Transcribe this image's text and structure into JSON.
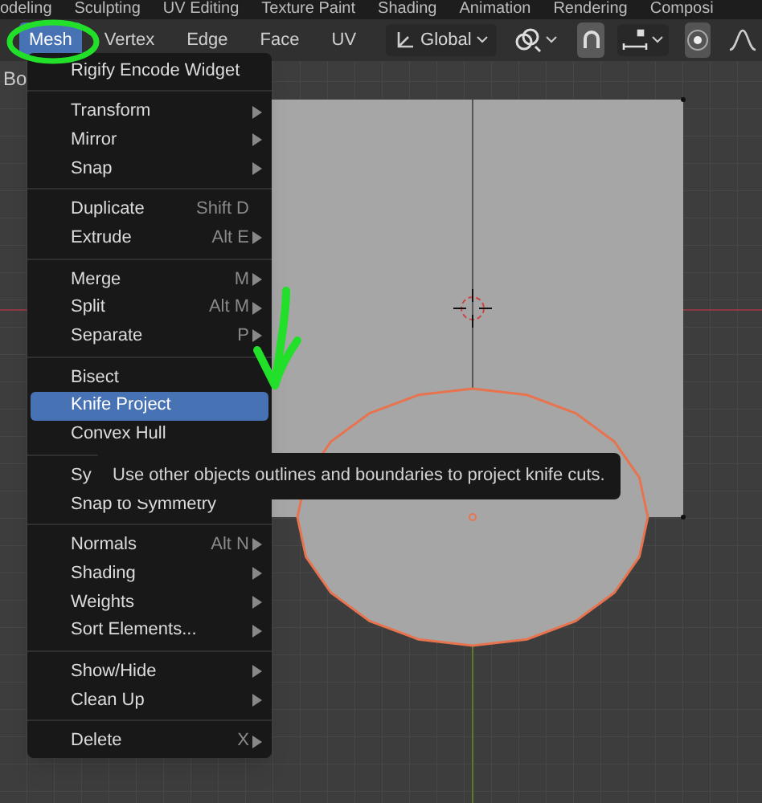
{
  "workspace_tabs": [
    "odeling",
    "Sculpting",
    "UV Editing",
    "Texture Paint",
    "Shading",
    "Animation",
    "Rendering",
    "Composi"
  ],
  "header": {
    "menus": [
      {
        "label": "Mesh",
        "selected": true
      },
      {
        "label": "Vertex",
        "selected": false
      },
      {
        "label": "Edge",
        "selected": false
      },
      {
        "label": "Face",
        "selected": false
      },
      {
        "label": "UV",
        "selected": false
      }
    ],
    "transform_orientation": "Global",
    "snap_on": true,
    "proportional_editing_on": true
  },
  "side_label": "Bo",
  "menu": {
    "items": [
      {
        "kind": "item",
        "label": "Rigify Encode Widget",
        "selected": false
      },
      {
        "kind": "separator"
      },
      {
        "kind": "item",
        "label": "Transform",
        "submenu": true,
        "selected": false
      },
      {
        "kind": "item",
        "label": "Mirror",
        "submenu": true,
        "selected": false
      },
      {
        "kind": "item",
        "label": "Snap",
        "submenu": true,
        "selected": false
      },
      {
        "kind": "separator"
      },
      {
        "kind": "item",
        "label": "Duplicate",
        "shortcut": "Shift D",
        "selected": false
      },
      {
        "kind": "item",
        "label": "Extrude",
        "shortcut": "Alt E",
        "submenu": true,
        "selected": false
      },
      {
        "kind": "separator"
      },
      {
        "kind": "item",
        "label": "Merge",
        "shortcut": "M",
        "submenu": true,
        "selected": false
      },
      {
        "kind": "item",
        "label": "Split",
        "shortcut": "Alt M",
        "submenu": true,
        "selected": false
      },
      {
        "kind": "item",
        "label": "Separate",
        "shortcut": "P",
        "submenu": true,
        "selected": false
      },
      {
        "kind": "separator"
      },
      {
        "kind": "item",
        "label": "Bisect",
        "selected": false
      },
      {
        "kind": "item",
        "label": "Knife Project",
        "selected": true
      },
      {
        "kind": "item",
        "label": "Convex Hull",
        "selected": false
      },
      {
        "kind": "separator"
      },
      {
        "kind": "item",
        "label": "Sy",
        "selected": false
      },
      {
        "kind": "item",
        "label": "Snap to Symmetry",
        "selected": false
      },
      {
        "kind": "separator"
      },
      {
        "kind": "item",
        "label": "Normals",
        "shortcut": "Alt N",
        "submenu": true,
        "selected": false
      },
      {
        "kind": "item",
        "label": "Shading",
        "submenu": true,
        "selected": false
      },
      {
        "kind": "item",
        "label": "Weights",
        "submenu": true,
        "selected": false
      },
      {
        "kind": "item",
        "label": "Sort Elements...",
        "submenu": true,
        "selected": false
      },
      {
        "kind": "separator"
      },
      {
        "kind": "item",
        "label": "Show/Hide",
        "submenu": true,
        "selected": false
      },
      {
        "kind": "item",
        "label": "Clean Up",
        "submenu": true,
        "selected": false
      },
      {
        "kind": "separator"
      },
      {
        "kind": "item",
        "label": "Delete",
        "shortcut": "X",
        "submenu": true,
        "selected": false
      }
    ]
  },
  "tooltip": "Use other objects outlines and boundaries to project knife cuts."
}
